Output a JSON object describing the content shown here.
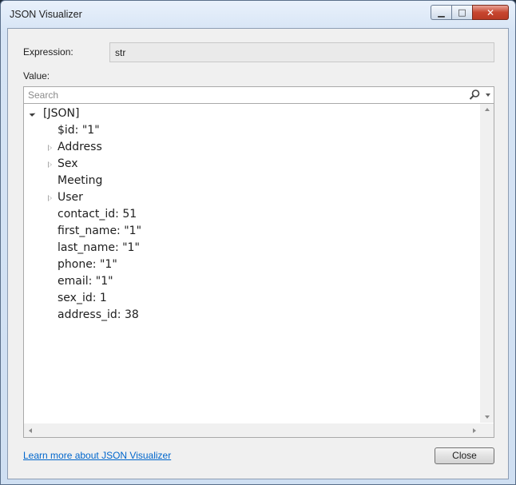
{
  "window": {
    "title": "JSON Visualizer",
    "minimize_glyph": "▁",
    "maximize_glyph": "□",
    "close_glyph": "✕"
  },
  "expression": {
    "label": "Expression:",
    "value": "str"
  },
  "value": {
    "label": "Value:"
  },
  "search": {
    "placeholder": "Search"
  },
  "tree": {
    "rows": [
      {
        "text": "[JSON]",
        "level": 0,
        "expander": "expanded"
      },
      {
        "text": "$id: \"1\"",
        "level": 1,
        "expander": "none"
      },
      {
        "text": "Address",
        "level": 1,
        "expander": "collapsed"
      },
      {
        "text": "Sex",
        "level": 1,
        "expander": "collapsed"
      },
      {
        "text": "Meeting",
        "level": 1,
        "expander": "none"
      },
      {
        "text": "User",
        "level": 1,
        "expander": "collapsed"
      },
      {
        "text": "contact_id: 51",
        "level": 1,
        "expander": "none"
      },
      {
        "text": "first_name: \"1\"",
        "level": 1,
        "expander": "none"
      },
      {
        "text": "last_name: \"1\"",
        "level": 1,
        "expander": "none"
      },
      {
        "text": "phone: \"1\"",
        "level": 1,
        "expander": "none"
      },
      {
        "text": "email: \"1\"",
        "level": 1,
        "expander": "none"
      },
      {
        "text": "sex_id: 1",
        "level": 1,
        "expander": "none"
      },
      {
        "text": "address_id: 38",
        "level": 1,
        "expander": "none"
      }
    ]
  },
  "footer": {
    "link_text": "Learn more about JSON Visualizer",
    "close_label": "Close"
  },
  "colors": {
    "link": "#0066cc",
    "close_button_red": "#c7462f"
  }
}
